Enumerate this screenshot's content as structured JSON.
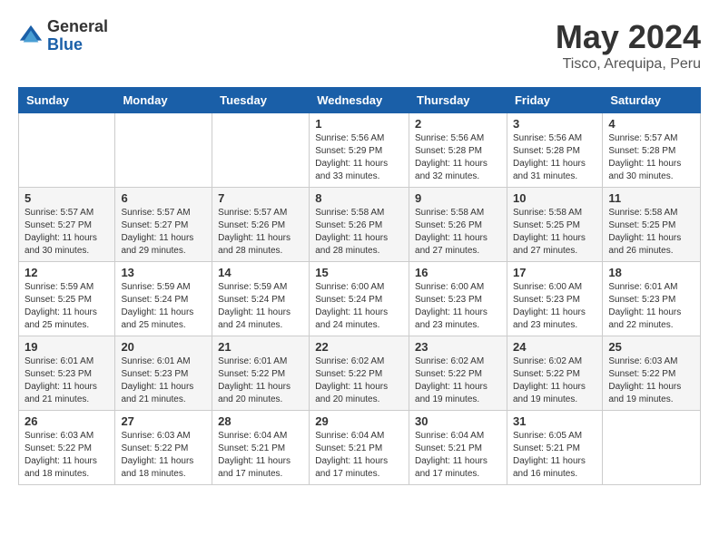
{
  "logo": {
    "general": "General",
    "blue": "Blue"
  },
  "title": "May 2024",
  "subtitle": "Tisco, Arequipa, Peru",
  "weekdays": [
    "Sunday",
    "Monday",
    "Tuesday",
    "Wednesday",
    "Thursday",
    "Friday",
    "Saturday"
  ],
  "weeks": [
    [
      {
        "day": "",
        "info": ""
      },
      {
        "day": "",
        "info": ""
      },
      {
        "day": "",
        "info": ""
      },
      {
        "day": "1",
        "info": "Sunrise: 5:56 AM\nSunset: 5:29 PM\nDaylight: 11 hours\nand 33 minutes."
      },
      {
        "day": "2",
        "info": "Sunrise: 5:56 AM\nSunset: 5:28 PM\nDaylight: 11 hours\nand 32 minutes."
      },
      {
        "day": "3",
        "info": "Sunrise: 5:56 AM\nSunset: 5:28 PM\nDaylight: 11 hours\nand 31 minutes."
      },
      {
        "day": "4",
        "info": "Sunrise: 5:57 AM\nSunset: 5:28 PM\nDaylight: 11 hours\nand 30 minutes."
      }
    ],
    [
      {
        "day": "5",
        "info": "Sunrise: 5:57 AM\nSunset: 5:27 PM\nDaylight: 11 hours\nand 30 minutes."
      },
      {
        "day": "6",
        "info": "Sunrise: 5:57 AM\nSunset: 5:27 PM\nDaylight: 11 hours\nand 29 minutes."
      },
      {
        "day": "7",
        "info": "Sunrise: 5:57 AM\nSunset: 5:26 PM\nDaylight: 11 hours\nand 28 minutes."
      },
      {
        "day": "8",
        "info": "Sunrise: 5:58 AM\nSunset: 5:26 PM\nDaylight: 11 hours\nand 28 minutes."
      },
      {
        "day": "9",
        "info": "Sunrise: 5:58 AM\nSunset: 5:26 PM\nDaylight: 11 hours\nand 27 minutes."
      },
      {
        "day": "10",
        "info": "Sunrise: 5:58 AM\nSunset: 5:25 PM\nDaylight: 11 hours\nand 27 minutes."
      },
      {
        "day": "11",
        "info": "Sunrise: 5:58 AM\nSunset: 5:25 PM\nDaylight: 11 hours\nand 26 minutes."
      }
    ],
    [
      {
        "day": "12",
        "info": "Sunrise: 5:59 AM\nSunset: 5:25 PM\nDaylight: 11 hours\nand 25 minutes."
      },
      {
        "day": "13",
        "info": "Sunrise: 5:59 AM\nSunset: 5:24 PM\nDaylight: 11 hours\nand 25 minutes."
      },
      {
        "day": "14",
        "info": "Sunrise: 5:59 AM\nSunset: 5:24 PM\nDaylight: 11 hours\nand 24 minutes."
      },
      {
        "day": "15",
        "info": "Sunrise: 6:00 AM\nSunset: 5:24 PM\nDaylight: 11 hours\nand 24 minutes."
      },
      {
        "day": "16",
        "info": "Sunrise: 6:00 AM\nSunset: 5:23 PM\nDaylight: 11 hours\nand 23 minutes."
      },
      {
        "day": "17",
        "info": "Sunrise: 6:00 AM\nSunset: 5:23 PM\nDaylight: 11 hours\nand 23 minutes."
      },
      {
        "day": "18",
        "info": "Sunrise: 6:01 AM\nSunset: 5:23 PM\nDaylight: 11 hours\nand 22 minutes."
      }
    ],
    [
      {
        "day": "19",
        "info": "Sunrise: 6:01 AM\nSunset: 5:23 PM\nDaylight: 11 hours\nand 21 minutes."
      },
      {
        "day": "20",
        "info": "Sunrise: 6:01 AM\nSunset: 5:23 PM\nDaylight: 11 hours\nand 21 minutes."
      },
      {
        "day": "21",
        "info": "Sunrise: 6:01 AM\nSunset: 5:22 PM\nDaylight: 11 hours\nand 20 minutes."
      },
      {
        "day": "22",
        "info": "Sunrise: 6:02 AM\nSunset: 5:22 PM\nDaylight: 11 hours\nand 20 minutes."
      },
      {
        "day": "23",
        "info": "Sunrise: 6:02 AM\nSunset: 5:22 PM\nDaylight: 11 hours\nand 19 minutes."
      },
      {
        "day": "24",
        "info": "Sunrise: 6:02 AM\nSunset: 5:22 PM\nDaylight: 11 hours\nand 19 minutes."
      },
      {
        "day": "25",
        "info": "Sunrise: 6:03 AM\nSunset: 5:22 PM\nDaylight: 11 hours\nand 19 minutes."
      }
    ],
    [
      {
        "day": "26",
        "info": "Sunrise: 6:03 AM\nSunset: 5:22 PM\nDaylight: 11 hours\nand 18 minutes."
      },
      {
        "day": "27",
        "info": "Sunrise: 6:03 AM\nSunset: 5:22 PM\nDaylight: 11 hours\nand 18 minutes."
      },
      {
        "day": "28",
        "info": "Sunrise: 6:04 AM\nSunset: 5:21 PM\nDaylight: 11 hours\nand 17 minutes."
      },
      {
        "day": "29",
        "info": "Sunrise: 6:04 AM\nSunset: 5:21 PM\nDaylight: 11 hours\nand 17 minutes."
      },
      {
        "day": "30",
        "info": "Sunrise: 6:04 AM\nSunset: 5:21 PM\nDaylight: 11 hours\nand 17 minutes."
      },
      {
        "day": "31",
        "info": "Sunrise: 6:05 AM\nSunset: 5:21 PM\nDaylight: 11 hours\nand 16 minutes."
      },
      {
        "day": "",
        "info": ""
      }
    ]
  ]
}
